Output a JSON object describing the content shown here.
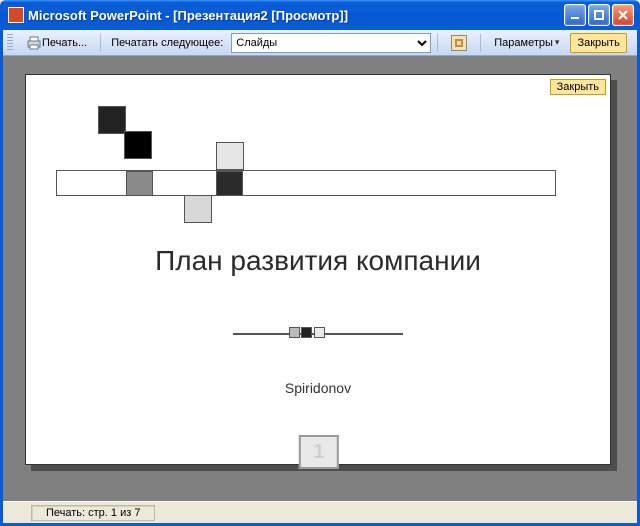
{
  "titlebar": {
    "app_title": "Microsoft PowerPoint - [Презентация2 [Просмотр]]"
  },
  "toolbar": {
    "print_label": "Печать...",
    "print_next_label": "Печатать следующее:",
    "select_value": "Слайды",
    "options_label": "Параметры",
    "close_label": "Закрыть"
  },
  "page": {
    "close_button": "Закрыть"
  },
  "slide": {
    "title": "План развития компании",
    "author": "Spiridonov",
    "page_number": "1"
  },
  "status": {
    "text": "Печать: стр. 1 из 7"
  },
  "colors": {
    "xp_blue": "#0a5bd6",
    "toolbar_bg": "#c7d8f4",
    "highlight": "#ffe69c"
  }
}
